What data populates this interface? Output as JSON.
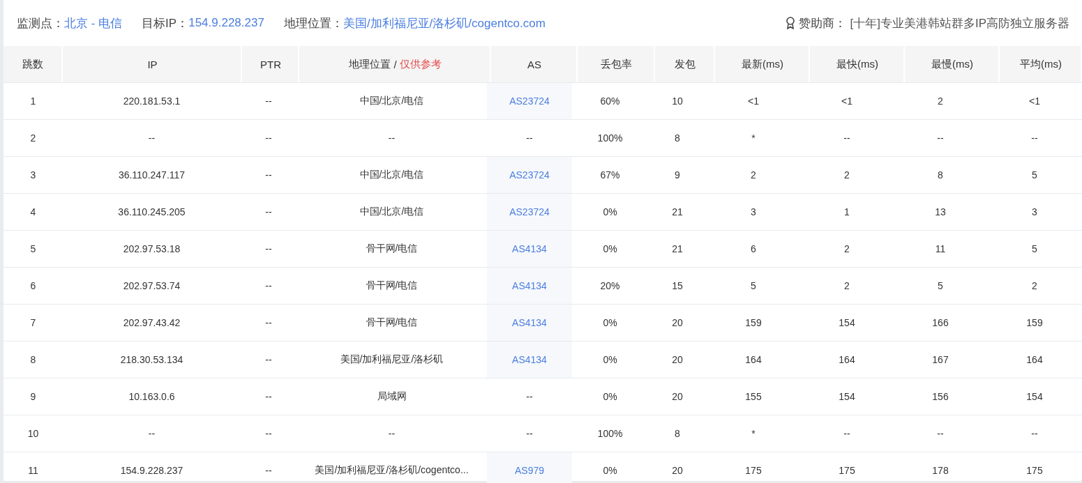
{
  "info_bar": {
    "monitor_label": "监测点：",
    "monitor_value": "北京 - 电信",
    "target_label": "目标IP：",
    "target_value": "154.9.228.237",
    "location_label": "地理位置：",
    "location_value": "美国/加利福尼亚/洛杉矶/cogentco.com",
    "sponsor_label": "赞助商：",
    "sponsor_value": "[十年]专业美港韩站群多IP高防独立服务器"
  },
  "table": {
    "columns": [
      "跳数",
      "IP",
      "PTR",
      "地理位置",
      "AS",
      "丢包率",
      "发包",
      "最新(ms)",
      "最快(ms)",
      "最慢(ms)",
      "平均(ms)"
    ],
    "geo_note_sep": " / ",
    "geo_note": "仅供参考",
    "rows": [
      {
        "hop": "1",
        "ip": "220.181.53.1",
        "ptr": "--",
        "geo": "中国/北京/电信",
        "as": "AS23724",
        "as_linked": true,
        "loss": "60%",
        "sent": "10",
        "last": "<1",
        "best": "<1",
        "worst": "2",
        "avg": "<1"
      },
      {
        "hop": "2",
        "ip": "--",
        "ptr": "--",
        "geo": "--",
        "as": "--",
        "as_linked": false,
        "loss": "100%",
        "sent": "8",
        "last": "*",
        "best": "--",
        "worst": "--",
        "avg": "--"
      },
      {
        "hop": "3",
        "ip": "36.110.247.117",
        "ptr": "--",
        "geo": "中国/北京/电信",
        "as": "AS23724",
        "as_linked": true,
        "loss": "67%",
        "sent": "9",
        "last": "2",
        "best": "2",
        "worst": "8",
        "avg": "5"
      },
      {
        "hop": "4",
        "ip": "36.110.245.205",
        "ptr": "--",
        "geo": "中国/北京/电信",
        "as": "AS23724",
        "as_linked": true,
        "loss": "0%",
        "sent": "21",
        "last": "3",
        "best": "1",
        "worst": "13",
        "avg": "3"
      },
      {
        "hop": "5",
        "ip": "202.97.53.18",
        "ptr": "--",
        "geo": "骨干网/电信",
        "as": "AS4134",
        "as_linked": true,
        "loss": "0%",
        "sent": "21",
        "last": "6",
        "best": "2",
        "worst": "11",
        "avg": "5"
      },
      {
        "hop": "6",
        "ip": "202.97.53.74",
        "ptr": "--",
        "geo": "骨干网/电信",
        "as": "AS4134",
        "as_linked": true,
        "loss": "20%",
        "sent": "15",
        "last": "5",
        "best": "2",
        "worst": "5",
        "avg": "2"
      },
      {
        "hop": "7",
        "ip": "202.97.43.42",
        "ptr": "--",
        "geo": "骨干网/电信",
        "as": "AS4134",
        "as_linked": true,
        "loss": "0%",
        "sent": "20",
        "last": "159",
        "best": "154",
        "worst": "166",
        "avg": "159"
      },
      {
        "hop": "8",
        "ip": "218.30.53.134",
        "ptr": "--",
        "geo": "美国/加利福尼亚/洛杉矶",
        "as": "AS4134",
        "as_linked": true,
        "loss": "0%",
        "sent": "20",
        "last": "164",
        "best": "164",
        "worst": "167",
        "avg": "164"
      },
      {
        "hop": "9",
        "ip": "10.163.0.6",
        "ptr": "--",
        "geo": "局域网",
        "as": "--",
        "as_linked": false,
        "loss": "0%",
        "sent": "20",
        "last": "155",
        "best": "154",
        "worst": "156",
        "avg": "154"
      },
      {
        "hop": "10",
        "ip": "--",
        "ptr": "--",
        "geo": "--",
        "as": "--",
        "as_linked": false,
        "loss": "100%",
        "sent": "8",
        "last": "*",
        "best": "--",
        "worst": "--",
        "avg": "--"
      },
      {
        "hop": "11",
        "ip": "154.9.228.237",
        "ptr": "--",
        "geo": "美国/加利福尼亚/洛杉矶/cogentco...",
        "as": "AS979",
        "as_linked": true,
        "loss": "0%",
        "sent": "20",
        "last": "175",
        "best": "175",
        "worst": "178",
        "avg": "175"
      }
    ]
  }
}
